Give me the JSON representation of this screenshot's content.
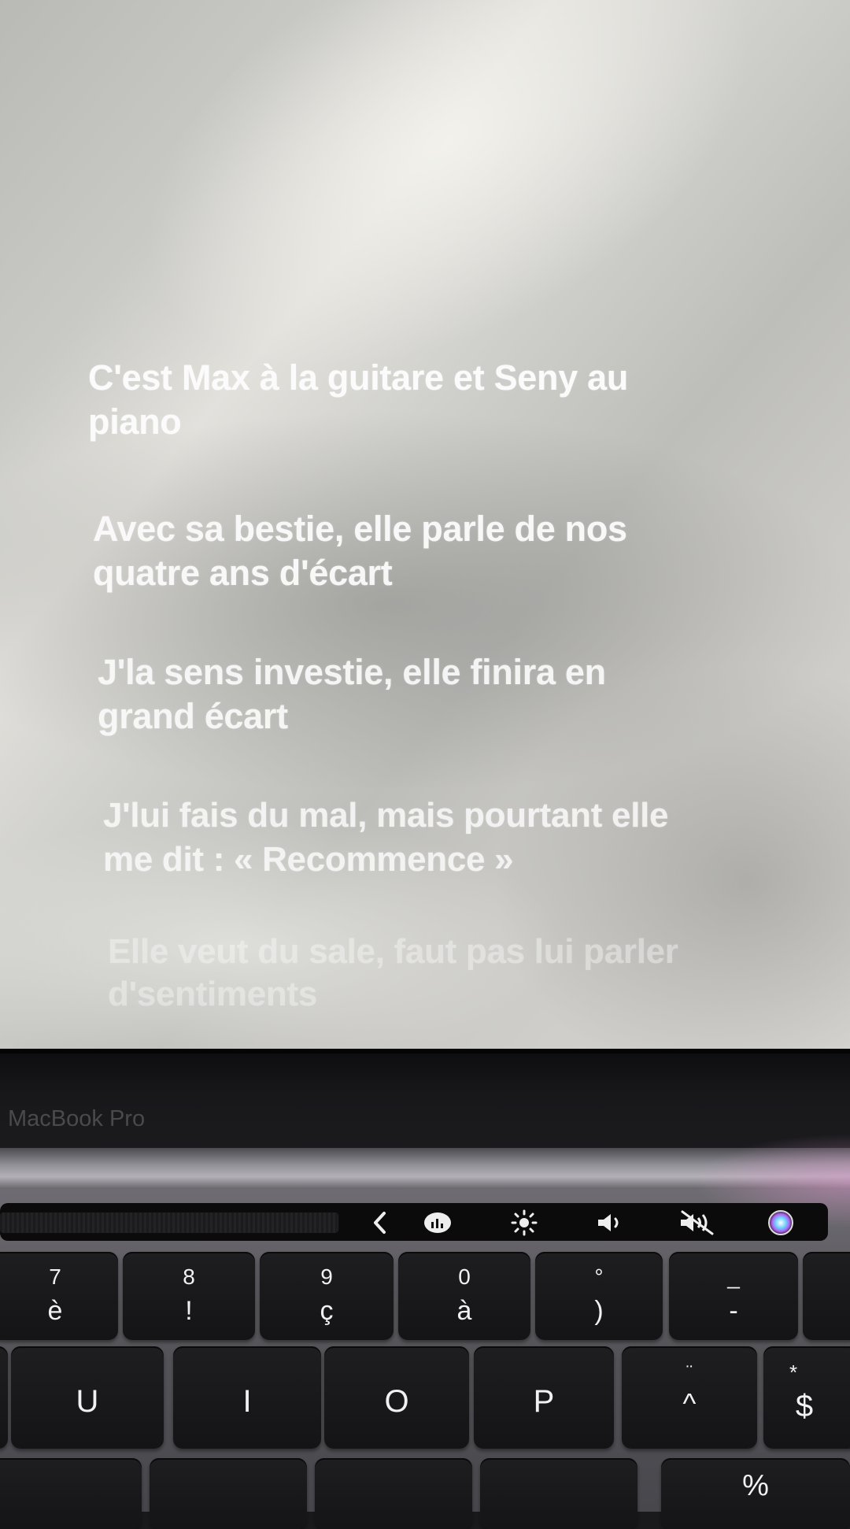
{
  "lyrics": [
    {
      "line1": "C'est Max à la guitare et Seny au",
      "line2": "piano"
    },
    {
      "line1": "Avec sa bestie, elle parle de nos",
      "line2": "quatre ans d'écart"
    },
    {
      "line1": "J'la sens investie, elle finira en",
      "line2": "grand écart"
    },
    {
      "line1": "J'lui fais du mal, mais pourtant elle",
      "line2": "me dit : « Recommence »"
    },
    {
      "line1": "Elle veut du sale, faut pas lui parler",
      "line2": "d'sentiments"
    }
  ],
  "bezel": {
    "brand": "MacBook Pro"
  },
  "touchbar": {
    "icons": [
      "chevron-left-icon",
      "dashboard-icon",
      "brightness-icon",
      "volume-icon",
      "mute-icon",
      "siri-icon"
    ]
  },
  "keys": {
    "row1": [
      {
        "top": "7",
        "bottom": "è"
      },
      {
        "top": "8",
        "bottom": "!"
      },
      {
        "top": "9",
        "bottom": "ç"
      },
      {
        "top": "0",
        "bottom": "à"
      },
      {
        "top": "°",
        "bottom": ")"
      },
      {
        "top": "_",
        "bottom": "-"
      }
    ],
    "row2": [
      {
        "label": "U"
      },
      {
        "label": "I"
      },
      {
        "label": "O"
      },
      {
        "label": "P"
      },
      {
        "top": "¨",
        "bottom": "^"
      },
      {
        "top": "*",
        "bottom": "$"
      }
    ],
    "row3": [
      {
        "label": "%"
      }
    ]
  }
}
